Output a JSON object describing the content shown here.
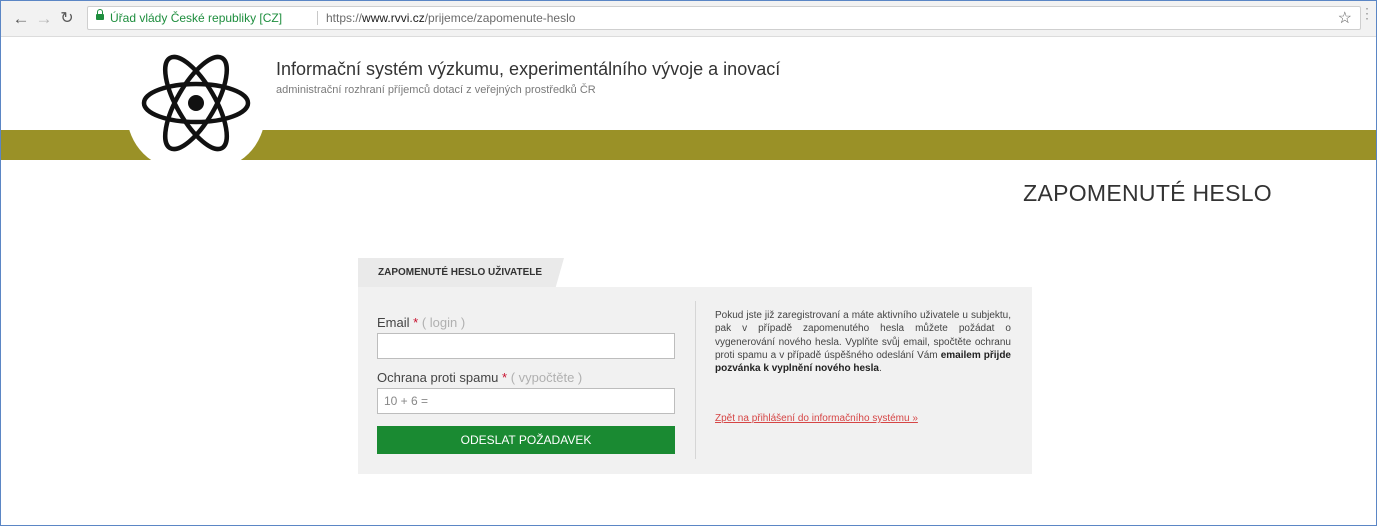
{
  "browser": {
    "site_identity": "Úřad vlády České republiky [CZ]",
    "url_scheme": "https://",
    "url_host": "www.rvvi.cz",
    "url_path": "/prijemce/zapomenute-heslo",
    "icons": {
      "back": "arrow-left-icon",
      "forward": "arrow-right-icon",
      "reload": "reload-icon",
      "secure": "lock-icon",
      "bookmark": "star-icon"
    }
  },
  "site": {
    "title": "Informační systém výzkumu, experimentálního vývoje a inovací",
    "subtitle": "administrační rozhraní příjemců dotací z veřejných prostředků ČR",
    "logo_icon": "atom-icon",
    "band_color": "#9a9127"
  },
  "page": {
    "title": "ZAPOMENUTÉ HESLO"
  },
  "form": {
    "tab_label": "ZAPOMENUTÉ HESLO UŽIVATELE",
    "email_label": "Email",
    "email_required": "*",
    "email_hint": "( login )",
    "email_value": "",
    "spam_label": "Ochrana proti spamu",
    "spam_required": "*",
    "spam_hint": "( vypočtěte )",
    "spam_placeholder": "10 + 6 =",
    "submit_label": "ODESLAT POŽADAVEK",
    "submit_color": "#1a8a32"
  },
  "info": {
    "text_1": "Pokud jste již zaregistrovaní a máte aktivního uživatele u subjektu, pak v případě zapomenutého hesla můžete požádat o vygenerování nového hesla. Vyplňte svůj email, spočtěte ochranu proti spamu a v případě úspěšného odeslání Vám ",
    "text_bold": "emailem přijde pozvánka k vyplnění nového hesla",
    "text_end": ".",
    "back_link": "Zpět na přihlášení do informačního systému »",
    "link_color": "#d64545"
  }
}
